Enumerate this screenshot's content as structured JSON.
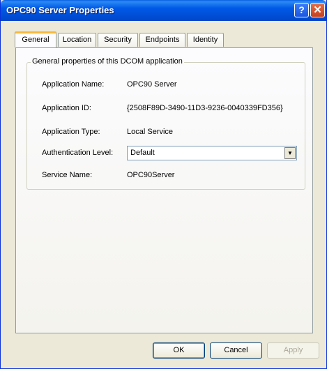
{
  "window": {
    "title": "OPC90 Server Properties",
    "help_glyph": "?",
    "close_glyph": "✕"
  },
  "tabs": [
    {
      "label": "General",
      "active": true
    },
    {
      "label": "Location",
      "active": false
    },
    {
      "label": "Security",
      "active": false
    },
    {
      "label": "Endpoints",
      "active": false
    },
    {
      "label": "Identity",
      "active": false
    }
  ],
  "group": {
    "title": "General properties of this DCOM application",
    "fields": [
      {
        "label": "Application Name:",
        "value": "OPC90 Server"
      },
      {
        "label": "Application ID:",
        "value": "{2508F89D-3490-11D3-9236-0040339FD356}"
      },
      {
        "label": "Application Type:",
        "value": "Local Service"
      },
      {
        "label": "Authentication Level:",
        "value": "Default"
      },
      {
        "label": "Service Name:",
        "value": "OPC90Server"
      }
    ]
  },
  "buttons": {
    "ok": "OK",
    "cancel": "Cancel",
    "apply": "Apply"
  }
}
